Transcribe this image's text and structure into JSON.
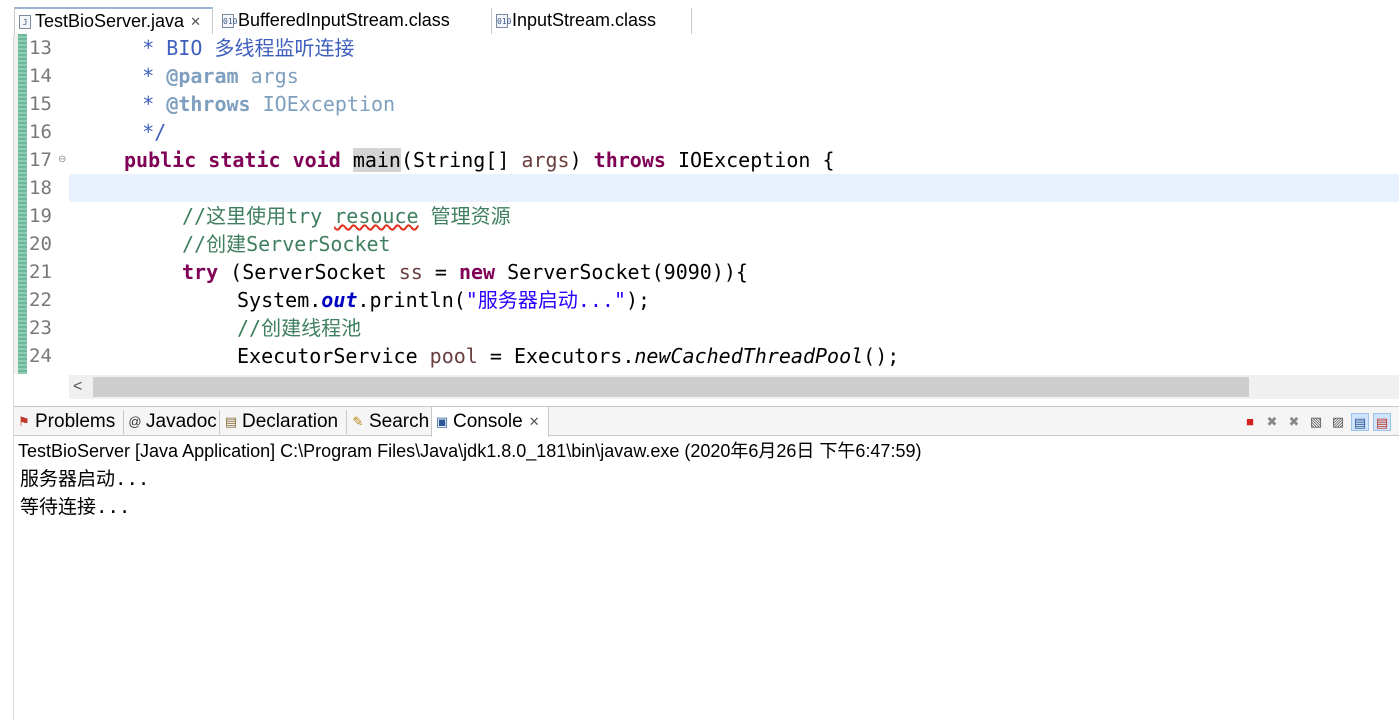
{
  "editor_tabs": [
    {
      "label": "TestBioServer.java",
      "close": "✕",
      "active": true
    },
    {
      "label": "BufferedInputStream.class",
      "active": false
    },
    {
      "label": "InputStream.class",
      "active": false
    }
  ],
  "lines": {
    "n13": "13",
    "n14": "14",
    "n15": "15",
    "n16": "16",
    "n17": "17",
    "n18": "18",
    "n19": "19",
    "n20": "20",
    "n21": "21",
    "n22": "22",
    "n23": "23",
    "n24": "24"
  },
  "code": {
    "l13_star": "     * ",
    "l13_text": "BIO 多线程监听连接",
    "l14_star": "     * ",
    "l14_tag": "@param",
    "l14_arg": " args",
    "l15_star": "     * ",
    "l15_tag": "@throws",
    "l15_arg": " IOException",
    "l16": "     */",
    "l17_kw1": "public",
    "l17_kw2": "static",
    "l17_kw3": "void",
    "l17_main": "main",
    "l17_sig": "(String[] ",
    "l17_args": "args",
    "l17_close": ") ",
    "l17_throws": "throws",
    "l17_exc": " IOException {",
    "l19_a": "//这里使用try ",
    "l19_squig": "resouce",
    "l19_b": " 管理资源",
    "l20": "//创建ServerSocket",
    "l21_try": "try",
    "l21_a": " (ServerSocket ",
    "l21_ss": "ss",
    "l21_b": " = ",
    "l21_new": "new",
    "l21_c": " ServerSocket(9090)){",
    "l22_a": "System.",
    "l22_out": "out",
    "l22_b": ".println(",
    "l22_str": "\"服务器启动...\"",
    "l22_c": ");",
    "l23": "//创建线程池",
    "l24_a": "ExecutorService ",
    "l24_pool": "pool",
    "l24_b": " = Executors.",
    "l24_m": "newCachedThreadPool",
    "l24_c": "();"
  },
  "scroll_left_arrow": "<",
  "panel_tabs": [
    {
      "label": "Problems",
      "icon": "problems-icon"
    },
    {
      "label": "Javadoc",
      "icon": "at-icon"
    },
    {
      "label": "Declaration",
      "icon": "declaration-icon"
    },
    {
      "label": "Search",
      "icon": "search-icon"
    },
    {
      "label": "Console",
      "icon": "console-icon",
      "close": "✕",
      "active": true
    }
  ],
  "console": {
    "title": "TestBioServer [Java Application] C:\\Program Files\\Java\\jdk1.8.0_181\\bin\\javaw.exe (2020年6月26日 下午6:47:59)",
    "output_line1": "服务器启动...",
    "output_line2": "等待连接..."
  },
  "colors": {
    "keyword": "#7f0055",
    "comment": "#3f7f5f",
    "javadoc": "#3f5fbf",
    "string": "#2a00ff",
    "current_line": "#e8f2fe"
  }
}
